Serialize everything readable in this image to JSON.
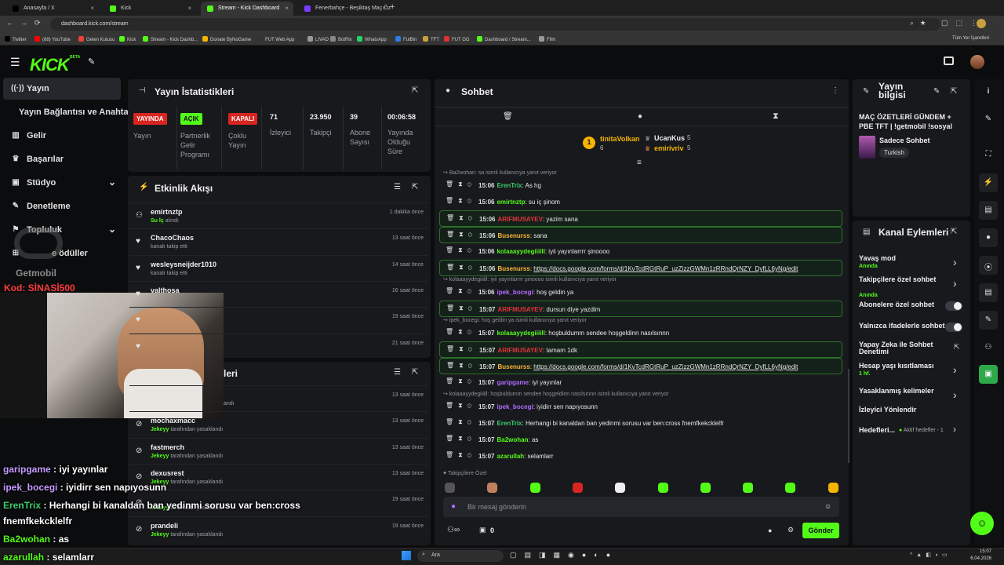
{
  "browser": {
    "tabs": [
      {
        "title": "Anasayfa / X",
        "color": "#000000"
      },
      {
        "title": "Kick",
        "color": "#53fc18"
      },
      {
        "title": "Stream - Kick Dashboard",
        "color": "#53fc18"
      },
      {
        "title": "Fenerbahçe - Beşiktaş Maç Öz",
        "color": "#7a3cff"
      }
    ],
    "url": "dashboard.kick.com/stream",
    "bookmarks": [
      {
        "label": "Twitter",
        "color": "#000000"
      },
      {
        "label": "(88) YouTube",
        "color": "#ff0000"
      },
      {
        "label": "Gelen Kutusu",
        "color": "#ea4335"
      },
      {
        "label": "Kick",
        "color": "#53fc18"
      },
      {
        "label": "Stream - Kick Dashb...",
        "color": "#53fc18"
      },
      {
        "label": "Donate ByNoGame",
        "color": "#f5b400"
      },
      {
        "label": "FUT Web App",
        "color": "#333333"
      },
      {
        "label": "LIVAD",
        "color": "#999999"
      },
      {
        "label": "BotRix",
        "color": "#888888"
      },
      {
        "label": "WhatsApp",
        "color": "#25d366"
      },
      {
        "label": "FutBin",
        "color": "#2a7de1"
      },
      {
        "label": "TFT",
        "color": "#c8a040"
      },
      {
        "label": "FUT GG",
        "color": "#e03030"
      },
      {
        "label": "Dashboard / Stream...",
        "color": "#53fc18"
      },
      {
        "label": "Film",
        "color": "#999999"
      }
    ],
    "all_bookmarks": "Tüm Yer İşaretleri"
  },
  "header": {
    "logo": "KICK",
    "logo_tag": "BETA"
  },
  "sidebar": {
    "items": [
      {
        "label": "Yayın",
        "icon": "broadcast-icon"
      },
      {
        "label": "Yayın Bağlantısı ve Anahtarı",
        "icon": ""
      },
      {
        "label": "Gelir",
        "icon": "revenue-icon"
      },
      {
        "label": "Başarılar",
        "icon": "trophy-icon"
      },
      {
        "label": "Stüdyo",
        "icon": "studio-icon"
      },
      {
        "label": "Denetleme",
        "icon": "wrench-icon"
      },
      {
        "label": "Topluluk",
        "icon": "community-icon"
      },
      {
        "label": "e ödüller",
        "icon": "rewards-icon"
      }
    ]
  },
  "stats_panel": {
    "title": "Yayın İstatistikleri",
    "live_badge": "YAYINDA",
    "live_label": "Yayın",
    "partner_badge": "AÇIK",
    "partner_label": "Partnerlik Gelir Programı",
    "multi_badge": "KAPALI",
    "multi_label": "Çoklu Yayın",
    "viewers_value": "71",
    "viewers_label": "İzleyici",
    "followers_value": "23.950",
    "followers_label": "Takipçi",
    "subs_value": "39",
    "subs_label": "Abone Sayısı",
    "uptime_value": "00:06:58",
    "uptime_label": "Yayında Olduğu Süre"
  },
  "activity_panel": {
    "title": "Etkinlik Akışı",
    "rows": [
      {
        "name": "emirtnztp",
        "sub_highlight": "Su İç",
        "sub": "alındı",
        "time": "1 dakika önce",
        "icon": "users-icon"
      },
      {
        "name": "ChacoChaos",
        "sub_highlight": "",
        "sub": "kanalı takip etti",
        "time": "13 saat önce",
        "icon": "heart-icon"
      },
      {
        "name": "wesleysneijder1010",
        "sub_highlight": "",
        "sub": "kanalı takip etti",
        "time": "14 saat önce",
        "icon": "heart-icon"
      },
      {
        "name": "valthosa",
        "sub_highlight": "",
        "sub": "",
        "time": "16 saat önce",
        "icon": "heart-icon"
      },
      {
        "name": "",
        "sub_highlight": "",
        "sub": "",
        "time": "19 saat önce",
        "icon": "heart-icon"
      },
      {
        "name": "",
        "sub_highlight": "",
        "sub": "",
        "time": "21 saat önce",
        "icon": "heart-icon"
      }
    ]
  },
  "bans_panel": {
    "title_fragment": "leri",
    "rows": [
      {
        "name": "",
        "mod": "",
        "suffix": "andı",
        "time": "13 saat önce"
      },
      {
        "name": "mochaxmacc",
        "mod": "Jekeyy",
        "suffix": "tarafından yasaklandı",
        "time": "13 saat önce"
      },
      {
        "name": "fastmerch",
        "mod": "Jekeyy",
        "suffix": "tarafından yasaklandı",
        "time": "13 saat önce"
      },
      {
        "name": "dexusrest",
        "mod": "Jekeyy",
        "suffix": "tarafından yasaklandı",
        "time": "13 saat önce"
      },
      {
        "name": "",
        "mod": "Jekeyy",
        "suffix": "tarafından yasaklandı",
        "time": "19 saat önce"
      },
      {
        "name": "prandeli",
        "mod": "Jekeyy",
        "suffix": "tarafından yasaklandı",
        "time": "19 saat önce"
      }
    ]
  },
  "chat": {
    "title": "Sohbet",
    "leader": {
      "rank": "1",
      "name": "tinitaVolkan",
      "count": "6"
    },
    "leader_others": [
      {
        "name": "UcanKus",
        "count": "5"
      },
      {
        "name": "emirivriv",
        "count": "5"
      }
    ],
    "messages": [
      {
        "reply": "Ba2wohan: sa isimli kullanıcıya yanıt veriyor",
        "time": "15:06",
        "user": "ErenTrix",
        "color": "#3bd16f",
        "text": "As hg",
        "hl": false,
        "link": false
      },
      {
        "reply": "",
        "time": "15:06",
        "user": "emirtnztp",
        "color": "#53fc18",
        "text": "su iç şinom",
        "hl": false,
        "link": false
      },
      {
        "reply": "",
        "time": "15:06",
        "user": "ARIFMUSAYEV",
        "color": "#e3343a",
        "text": "yazim sana",
        "hl": true,
        "link": false
      },
      {
        "reply": "",
        "time": "15:06",
        "user": "Busenurss",
        "color": "#ffb43a",
        "text": "sana",
        "hl": true,
        "link": false
      },
      {
        "reply": "",
        "time": "15:06",
        "user": "kolaaayydegiiiill",
        "color": "#53fc18",
        "text": "iyii yayınlarrrr şinoooo",
        "hl": false,
        "link": false
      },
      {
        "reply": "",
        "time": "15:06",
        "user": "Busenurss",
        "color": "#ffb43a",
        "text": "https://docs.google.com/forms/d/1KvTcdRGtRuP_uzZizzGWMn1zRRndQrNZY_DyfLL6yNg/edit",
        "hl": true,
        "link": true
      },
      {
        "reply": "kolaaayydegiiiill: iyii yayınlarrrr şinoooo isimli kullanıcıya yanıt veriyor",
        "time": "15:06",
        "user": "ipek_bocegi",
        "color": "#b06cff",
        "text": "hoş geldin ya",
        "hl": false,
        "link": false
      },
      {
        "reply": "",
        "time": "15:07",
        "user": "ARIFMUSAYEV",
        "color": "#e3343a",
        "text": "dursun diye yazdim",
        "hl": true,
        "link": false
      },
      {
        "reply": "ipek_bocegi: hoş geldin ya isimli kullanıcıya yanıt veriyor",
        "time": "15:07",
        "user": "kolaaayydegiiiill",
        "color": "#53fc18",
        "text": "hoşbuldumm sendee hoşgeldinn nasılsınnn",
        "hl": false,
        "link": false
      },
      {
        "reply": "",
        "time": "15:07",
        "user": "ARIFMUSAYEV",
        "color": "#e3343a",
        "text": "tamam 1dk",
        "hl": true,
        "link": false
      },
      {
        "reply": "",
        "time": "15:07",
        "user": "Busenurss",
        "color": "#ffb43a",
        "text": "https://docs.google.com/forms/d/1KvTcdRGtRuP_uzZizzGWMn1zRRndQrNZY_DyfLL6yNg/edit",
        "hl": true,
        "link": true
      },
      {
        "reply": "",
        "time": "15:07",
        "user": "garipgame",
        "color": "#b06cff",
        "text": "iyi yayınlar",
        "hl": false,
        "link": false
      },
      {
        "reply": "kolaaayydegiiiill: hoşbuldumm sendee hoşgeldinn nasılsınnn isimli kullanıcıya yanıt veriyor",
        "time": "15:07",
        "user": "ipek_bocegi",
        "color": "#b06cff",
        "text": "iyidirr sen napıyosunn",
        "hl": false,
        "link": false
      },
      {
        "reply": "",
        "time": "15:07",
        "user": "ErenTrix",
        "color": "#3bd16f",
        "text": "Herhangi bi kanaldan ban yedinmi sorusu var ben:cross fnemfkekcklelfr",
        "hl": false,
        "link": false
      },
      {
        "reply": "",
        "time": "15:07",
        "user": "Ba2wohan",
        "color": "#53fc18",
        "text": "as",
        "hl": false,
        "link": false
      },
      {
        "reply": "",
        "time": "15:07",
        "user": "azarullah",
        "color": "#53fc18",
        "text": "selamlarr",
        "hl": false,
        "link": false
      }
    ],
    "followers_only_label": "Takipçilere Özel",
    "input_placeholder": "Bir mesaj gönderin",
    "points_count": "0",
    "send_label": "Gönder"
  },
  "stream_info": {
    "title": "Yayın bilgisi",
    "stream_title": "MAÇ ÖZETLERİ GÜNDEM + PBE TFT | !getmobil !sosyal",
    "category": "Sadece Sohbet",
    "language_tag": "Turkish"
  },
  "channel_actions": {
    "title": "Kanal Eylemleri",
    "items": [
      {
        "label": "Yavaş mod",
        "sub": "Anında",
        "kind": "chevron"
      },
      {
        "label": "Takipçilere özel sohbet",
        "sub": "Anında",
        "kind": "chevron"
      },
      {
        "label": "Abonelere özel sohbet",
        "sub": "",
        "kind": "toggle"
      },
      {
        "label": "Yalnızca ifadelerle sohbet",
        "sub": "",
        "kind": "toggle"
      },
      {
        "label": "Yapay Zeka ile Sohbet Denetimi",
        "sub": "",
        "kind": "external"
      },
      {
        "label": "Hesap yaşı kısıtlaması",
        "sub": "1 hf.",
        "kind": "chevron"
      },
      {
        "label": "Yasaklanmış kelimeler",
        "sub": "",
        "kind": "chevron"
      },
      {
        "label": "İzleyici Yönlendir",
        "sub": "",
        "kind": "none"
      }
    ],
    "goals_label": "Hedefleri...",
    "goals_status": "Aktif hedefler - 1"
  },
  "overlay": {
    "sponsor": "Getmobil",
    "code_label": "Kod:",
    "code_value": "SİNASİ500",
    "chat": [
      {
        "user": "garipgame",
        "color": "#c59bff",
        "text": "iyi yayınlar"
      },
      {
        "user": "ipek_bocegi",
        "color": "#c59bff",
        "text": "iyidirr sen napıyosunn"
      },
      {
        "user": "ErenTrix",
        "color": "#3bd16f",
        "text": "Herhangi bi kanaldan ban yedinmi sorusu var ben:cross fnemfkekcklelfr"
      },
      {
        "user": "Ba2wohan",
        "color": "#53fc18",
        "text": "as"
      },
      {
        "user": "azarullah",
        "color": "#53fc18",
        "text": "selamlarr"
      }
    ]
  },
  "taskbar": {
    "search": "Ara",
    "time": "15:07",
    "date": "6.04.2026"
  }
}
